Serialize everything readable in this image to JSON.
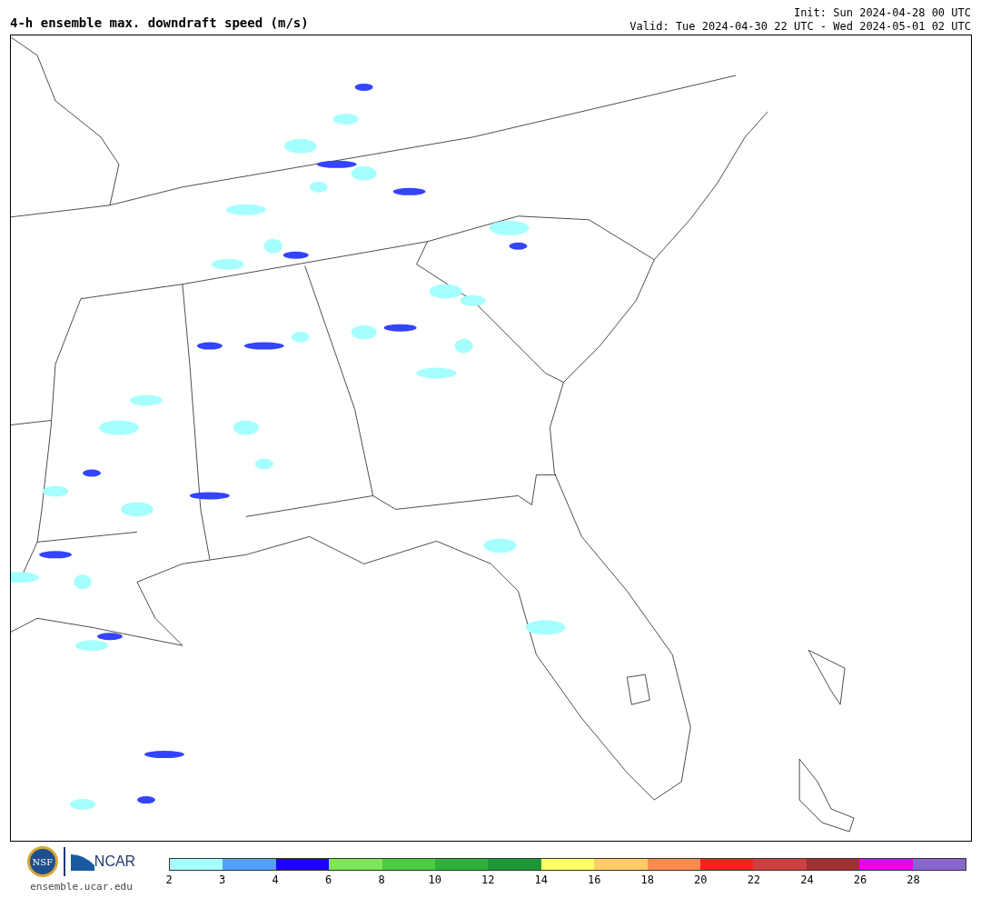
{
  "title": "4-h ensemble max. downdraft speed (m/s)",
  "init": "Init: Sun 2024-04-28 00 UTC",
  "valid": "Valid: Tue 2024-04-30 22 UTC - Wed 2024-05-01 02 UTC",
  "logo": {
    "nsf": "NSF",
    "ncar": "NCAR",
    "url": "ensemble.ucar.edu"
  },
  "colorbar": {
    "bins": [
      {
        "color": "#a6ffff"
      },
      {
        "color": "#55a0ff"
      },
      {
        "color": "#1e00ff"
      },
      {
        "color": "#80e55a"
      },
      {
        "color": "#4ccc44"
      },
      {
        "color": "#2eb03a"
      },
      {
        "color": "#1f9638"
      },
      {
        "color": "#ffff66"
      },
      {
        "color": "#ffcc66"
      },
      {
        "color": "#ff8a50"
      },
      {
        "color": "#ff1e1e"
      },
      {
        "color": "#cc4040"
      },
      {
        "color": "#a03030"
      },
      {
        "color": "#ee00ee"
      },
      {
        "color": "#8866cc"
      }
    ],
    "tick_labels": [
      "2",
      "3",
      "4",
      "6",
      "8",
      "10",
      "12",
      "14",
      "16",
      "18",
      "20",
      "22",
      "24",
      "26",
      "28"
    ]
  }
}
